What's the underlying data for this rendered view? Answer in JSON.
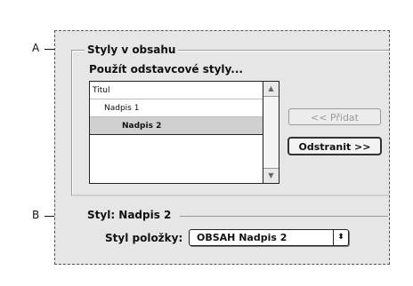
{
  "callouts": {
    "a": "A",
    "b": "B"
  },
  "contents_group": {
    "title": "Styly v obsahu",
    "list_heading": "Použít odstavcové styly...",
    "styles": [
      {
        "label": "Titul"
      },
      {
        "label": "Nadpis 1"
      },
      {
        "label": "Nadpis 2",
        "selected": true
      }
    ],
    "add_button": "<< Přidat",
    "remove_button": "Odstranit >>"
  },
  "style_group": {
    "title": "Styl: Nadpis 2",
    "entry_label": "Styl položky:",
    "entry_value": "OBSAH Nadpis 2"
  },
  "icons": {
    "scroll_up": "▲",
    "scroll_down": "▼",
    "popup_arrows": "⬍"
  },
  "colors": {
    "panel_bg": "#e6e6e6",
    "selected_row": "#d0d0d0"
  }
}
